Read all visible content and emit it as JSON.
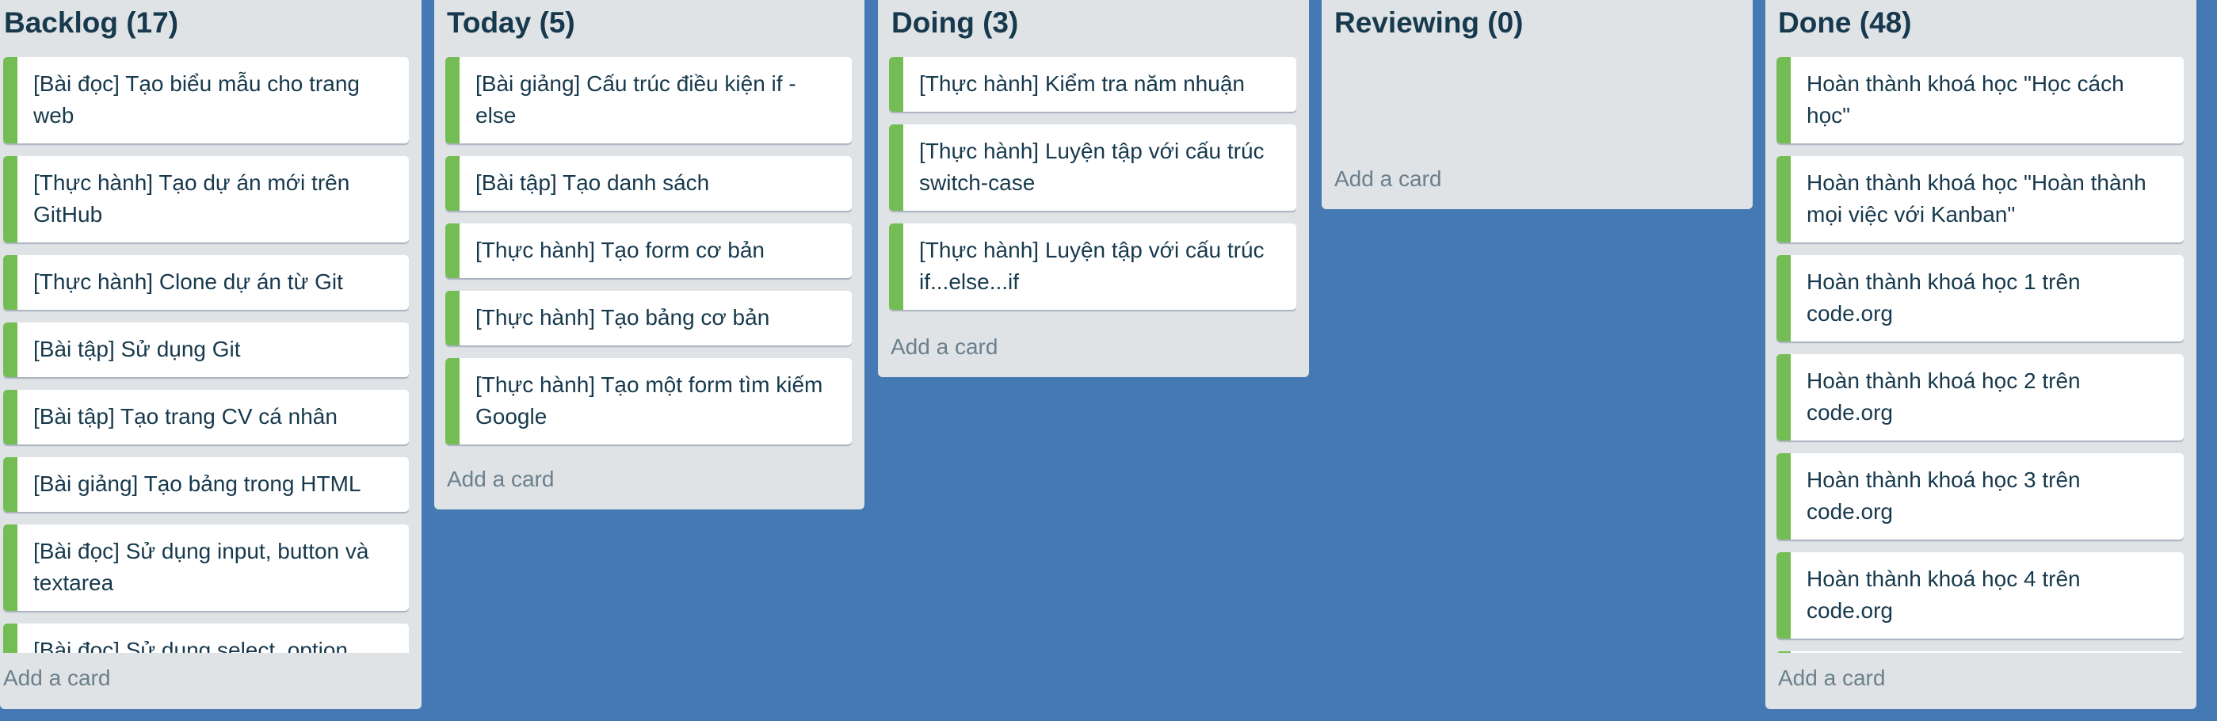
{
  "board": {
    "background_color": "#4479b4",
    "label_color": "#74bd55",
    "lists": [
      {
        "title": "Backlog (17)",
        "add_card_label": "Add a card",
        "cards": [
          "[Bài đọc] Tạo biểu mẫu cho trang web",
          "[Thực hành] Tạo dự án mới trên GitHub",
          "[Thực hành] Clone dự án từ Git",
          "[Bài tập] Sử dụng Git",
          "[Bài tập] Tạo trang CV cá nhân",
          "[Bài giảng] Tạo bảng trong HTML",
          "[Bài đọc] Sử dụng input, button và textarea",
          "[Bài đọc] Sử dụng select, option"
        ]
      },
      {
        "title": "Today (5)",
        "add_card_label": "Add a card",
        "cards": [
          "[Bài giảng] Cấu trúc điều kiện if - else",
          "[Bài tập] Tạo danh sách",
          "[Thực hành] Tạo form cơ bản",
          "[Thực hành] Tạo bảng cơ bản",
          "[Thực hành] Tạo một form tìm kiếm Google"
        ]
      },
      {
        "title": "Doing (3)",
        "add_card_label": "Add a card",
        "cards": [
          "[Thực hành] Kiểm tra năm nhuận",
          "[Thực hành] Luyện tập với cấu trúc switch-case",
          "[Thực hành] Luyện tập với cấu trúc if...else...if"
        ]
      },
      {
        "title": "Reviewing (0)",
        "add_card_label": "Add a card",
        "cards": []
      },
      {
        "title": "Done (48)",
        "add_card_label": "Add a card",
        "cards": [
          "Hoàn thành khoá học \"Học cách học\"",
          "Hoàn thành khoá học \"Hoàn thành mọi việc với Kanban\"",
          "Hoàn thành khoá học 1 trên code.org",
          "Hoàn thành khoá học 2 trên code.org",
          "Hoàn thành khoá học 3 trên code.org",
          "Hoàn thành khoá học 4 trên code.org",
          ""
        ]
      }
    ]
  }
}
